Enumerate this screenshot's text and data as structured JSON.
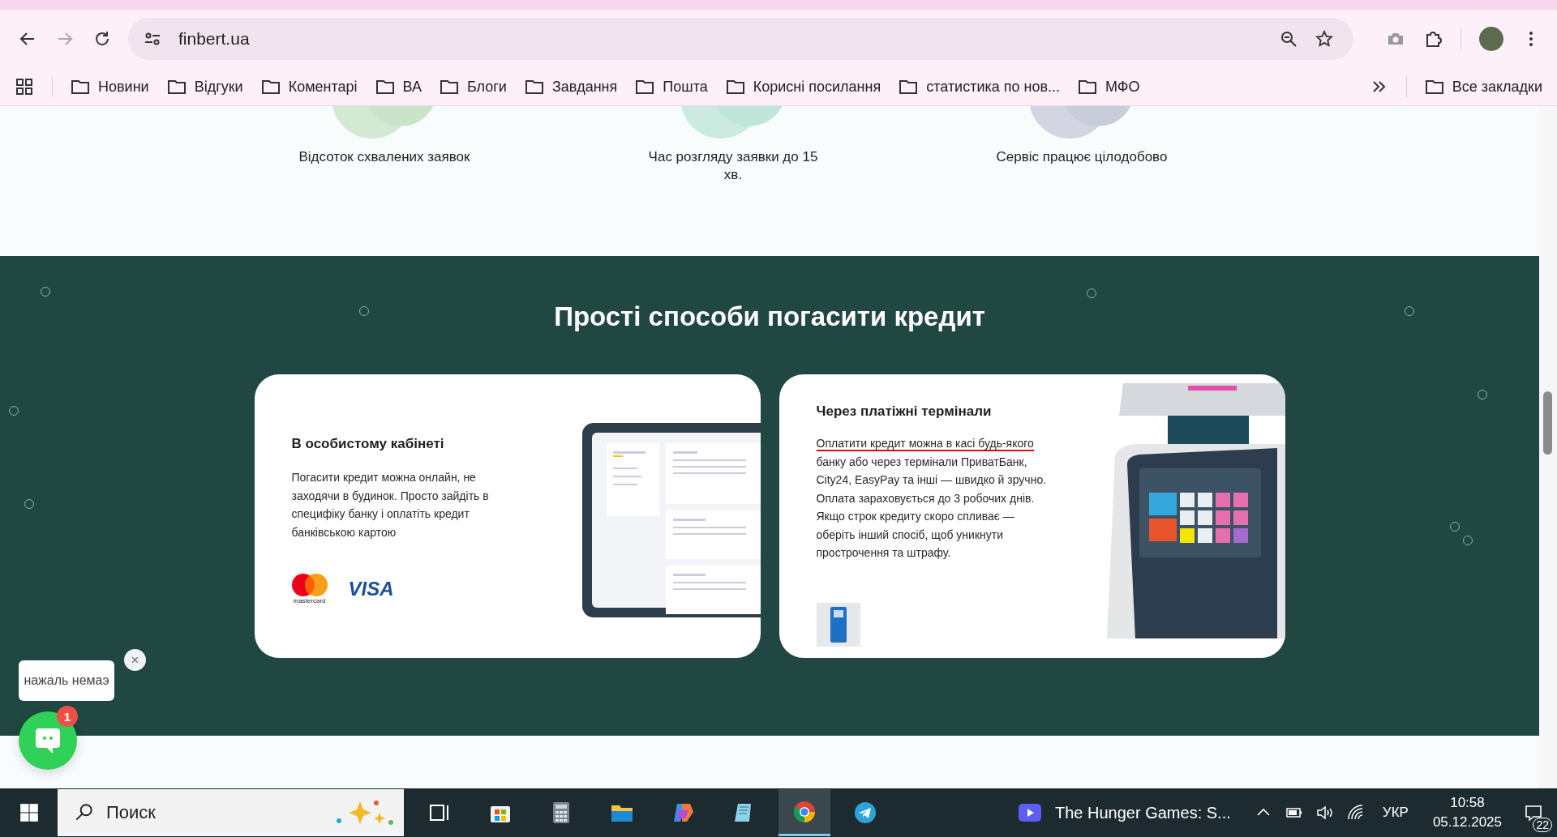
{
  "browser": {
    "address": "finbert.ua",
    "forward_disabled": true,
    "bookmarks": [
      {
        "label": "Новини"
      },
      {
        "label": "Відгуки"
      },
      {
        "label": "Коментарі"
      },
      {
        "label": "ВА"
      },
      {
        "label": "Блоги"
      },
      {
        "label": "Завдання"
      },
      {
        "label": "Пошта"
      },
      {
        "label": "Корисні посилання"
      },
      {
        "label": "статистика по нов..."
      },
      {
        "label": "МФО"
      }
    ],
    "all_bookmarks": "Все закладки"
  },
  "stats": [
    {
      "label": "Відсоток схвалених заявок",
      "color": "#c9e4c8"
    },
    {
      "label": "Час розгляду заявки до 15 хв.",
      "color": "#bfe6d8"
    },
    {
      "label": "Сервіс працює цілодобово",
      "color": "#c9ccdb"
    }
  ],
  "payment_section": {
    "title": "Прості способи погасити кредит",
    "cards": [
      {
        "kind": "cabinet",
        "title": "В особистому кабінеті",
        "text": "Погасити кредит можна онлайн, не заходячи в будинок. Просто зайдіть в специфіку банку і оплатіть кредит банківською картою",
        "mastercard": "mastercard",
        "visa": "VISA"
      },
      {
        "kind": "terminal",
        "title": "Через платіжні термінали",
        "underlined": "Оплатити кредит можна в касі будь-якого",
        "text": "банку або через термінали ПриватБанк, City24, EasyPay та інші — швидко й зручно. Оплата зараховується до 3 робочих днів. Якщо строк кредиту скоро спливає — оберіть інший спосіб, щоб уникнути прострочення та штрафу."
      }
    ]
  },
  "chat": {
    "message": "нажаль немаэ",
    "close": "×",
    "badge": "1"
  },
  "taskbar": {
    "search_placeholder": "Поиск",
    "apps": [
      {
        "kind": "taskview",
        "selected": false
      },
      {
        "kind": "store",
        "selected": false
      },
      {
        "kind": "calculator",
        "selected": false
      },
      {
        "kind": "explorer",
        "selected": false
      },
      {
        "kind": "copilot",
        "selected": false
      },
      {
        "kind": "notepad",
        "selected": false
      },
      {
        "kind": "chrome",
        "selected": true
      },
      {
        "kind": "telegram",
        "selected": false
      }
    ],
    "media": "The Hunger Games: S...",
    "language": "УКР",
    "time": "10:58",
    "date": "05.12.2025",
    "notifications": "22"
  }
}
